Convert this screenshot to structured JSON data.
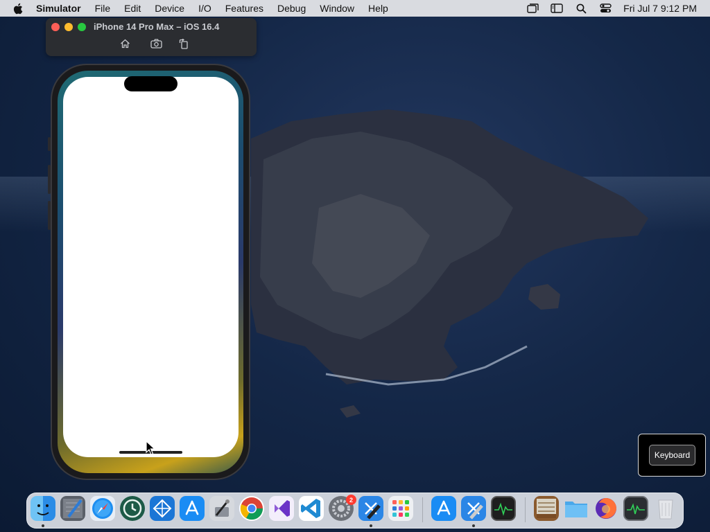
{
  "menubar": {
    "app_name": "Simulator",
    "items": [
      "File",
      "Edit",
      "Device",
      "I/O",
      "Features",
      "Debug",
      "Window",
      "Help"
    ],
    "clock": "Fri Jul 7  9:12 PM"
  },
  "simulator": {
    "title": "iPhone 14 Pro Max – iOS 16.4"
  },
  "keyboard_popup": {
    "label": "Keyboard"
  },
  "dock": {
    "badge_count": "2",
    "apps": [
      "finder-icon",
      "instruments-icon",
      "safari-icon",
      "time-machine-icon",
      "simulator-icon",
      "app-store-icon",
      "xcode-tools-icon",
      "chrome-icon",
      "visual-studio-icon",
      "vscode-icon",
      "system-preferences-icon",
      "xcode-icon",
      "launchpad-icon",
      "app-store-icon",
      "xcode-icon",
      "console-icon",
      "archive-icon",
      "folder-icon",
      "firefox-icon",
      "activity-monitor-icon",
      "trash-icon"
    ]
  },
  "colors": {
    "close": "#fe5f57",
    "minimize": "#febc2e",
    "maximize": "#28c840"
  }
}
